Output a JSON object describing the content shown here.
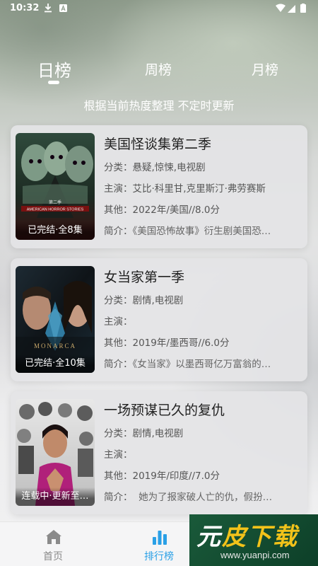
{
  "status_bar": {
    "time": "10:32"
  },
  "tabs": [
    {
      "label": "日榜",
      "active": true
    },
    {
      "label": "周榜",
      "active": false
    },
    {
      "label": "月榜",
      "active": false
    }
  ],
  "subtitle": "根据当前热度整理 不定时更新",
  "labels": {
    "category": "分类：",
    "cast": "主演：",
    "other": "其他：",
    "intro": "简介："
  },
  "items": [
    {
      "title": "美国怪谈集第二季",
      "status": "已完结·全8集",
      "category": "悬疑,惊悚,电视剧",
      "cast": "艾比·科里甘,克里斯汀·弗劳赛斯",
      "other": "2022年/美国//8.0分",
      "intro": "《美国恐怖故事》衍生剧美国恐…",
      "poster_text": "AMERICAN HORROR STORIES",
      "poster_season": "第二季"
    },
    {
      "title": "女当家第一季",
      "status": "已完结·全10集",
      "category": "剧情,电视剧",
      "cast": "",
      "other": "2019年/墨西哥//6.0分",
      "intro": "《女当家》以墨西哥亿万富翁的…",
      "poster_text": "MONARCA"
    },
    {
      "title": "一场预谋已久的复仇",
      "status": "连载中·更新至…",
      "category": "剧情,电视剧",
      "cast": "",
      "other": "2019年/印度//7.0分",
      "intro": "  她为了报家破人亡的仇，假扮…"
    }
  ],
  "bottom_nav": [
    {
      "label": "首页",
      "icon": "home-icon",
      "active": false
    },
    {
      "label": "排行榜",
      "icon": "ranking-icon",
      "active": true
    }
  ],
  "watermark": {
    "text_a": "元",
    "text_b": "皮下载",
    "url": "www.yuanpi.com"
  },
  "colors": {
    "accent": "#2aa0e6",
    "card_bg": "#e4e4e6",
    "title_text": "#222222"
  }
}
